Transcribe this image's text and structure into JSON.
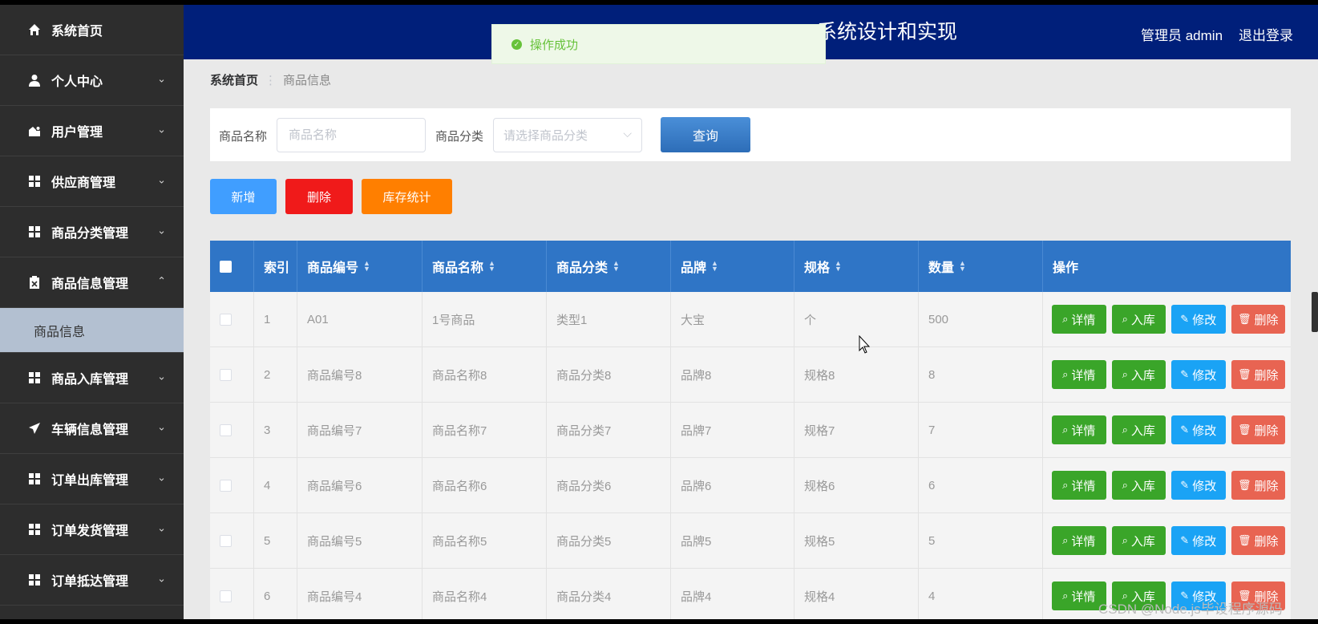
{
  "sidebar": {
    "items": [
      {
        "label": "系统首页",
        "icon": "home-icon",
        "has_chevron": false
      },
      {
        "label": "个人中心",
        "icon": "user-icon",
        "chevron": "⌄"
      },
      {
        "label": "用户管理",
        "icon": "user-manage-icon",
        "chevron": "⌄"
      },
      {
        "label": "供应商管理",
        "icon": "grid-icon",
        "chevron": "⌄"
      },
      {
        "label": "商品分类管理",
        "icon": "grid-icon",
        "chevron": "⌄"
      },
      {
        "label": "商品信息管理",
        "icon": "clipboard-icon",
        "chevron": "⌃"
      },
      {
        "label": "商品入库管理",
        "icon": "grid-icon",
        "chevron": "⌄"
      },
      {
        "label": "车辆信息管理",
        "icon": "send-icon",
        "chevron": "⌄"
      },
      {
        "label": "订单出库管理",
        "icon": "grid-icon",
        "chevron": "⌄"
      },
      {
        "label": "订单发货管理",
        "icon": "grid-icon",
        "chevron": "⌄"
      },
      {
        "label": "订单抵达管理",
        "icon": "grid-icon",
        "chevron": "⌄"
      }
    ],
    "sub_item": "商品信息"
  },
  "header": {
    "title_visible": "系统设计和实现",
    "user": "管理员 admin",
    "logout": "退出登录",
    "bg_color": "#001f7a"
  },
  "toast": {
    "text": "操作成功",
    "color": "#67c23a"
  },
  "breadcrumb": {
    "home": "系统首页",
    "current": "商品信息"
  },
  "search": {
    "name_label": "商品名称",
    "name_placeholder": "商品名称",
    "category_label": "商品分类",
    "category_placeholder": "请选择商品分类",
    "query_button": "查询"
  },
  "actions": {
    "add": "新增",
    "delete": "删除",
    "stats": "库存统计"
  },
  "table": {
    "headers": [
      "索引",
      "商品编号",
      "商品名称",
      "商品分类",
      "品牌",
      "规格",
      "数量",
      "操作"
    ],
    "rows": [
      [
        "1",
        "A01",
        "1号商品",
        "类型1",
        "大宝",
        "个",
        "500"
      ],
      [
        "2",
        "商品编号8",
        "商品名称8",
        "商品分类8",
        "品牌8",
        "规格8",
        "8"
      ],
      [
        "3",
        "商品编号7",
        "商品名称7",
        "商品分类7",
        "品牌7",
        "规格7",
        "7"
      ],
      [
        "4",
        "商品编号6",
        "商品名称6",
        "商品分类6",
        "品牌6",
        "规格6",
        "6"
      ],
      [
        "5",
        "商品编号5",
        "商品名称5",
        "商品分类5",
        "品牌5",
        "规格5",
        "5"
      ],
      [
        "6",
        "商品编号4",
        "商品名称4",
        "商品分类4",
        "品牌4",
        "规格4",
        "4"
      ]
    ],
    "row_actions": [
      "详情",
      "入库",
      "修改",
      "删除"
    ]
  },
  "watermark": "CSDN @Node.js毕设程序源码"
}
